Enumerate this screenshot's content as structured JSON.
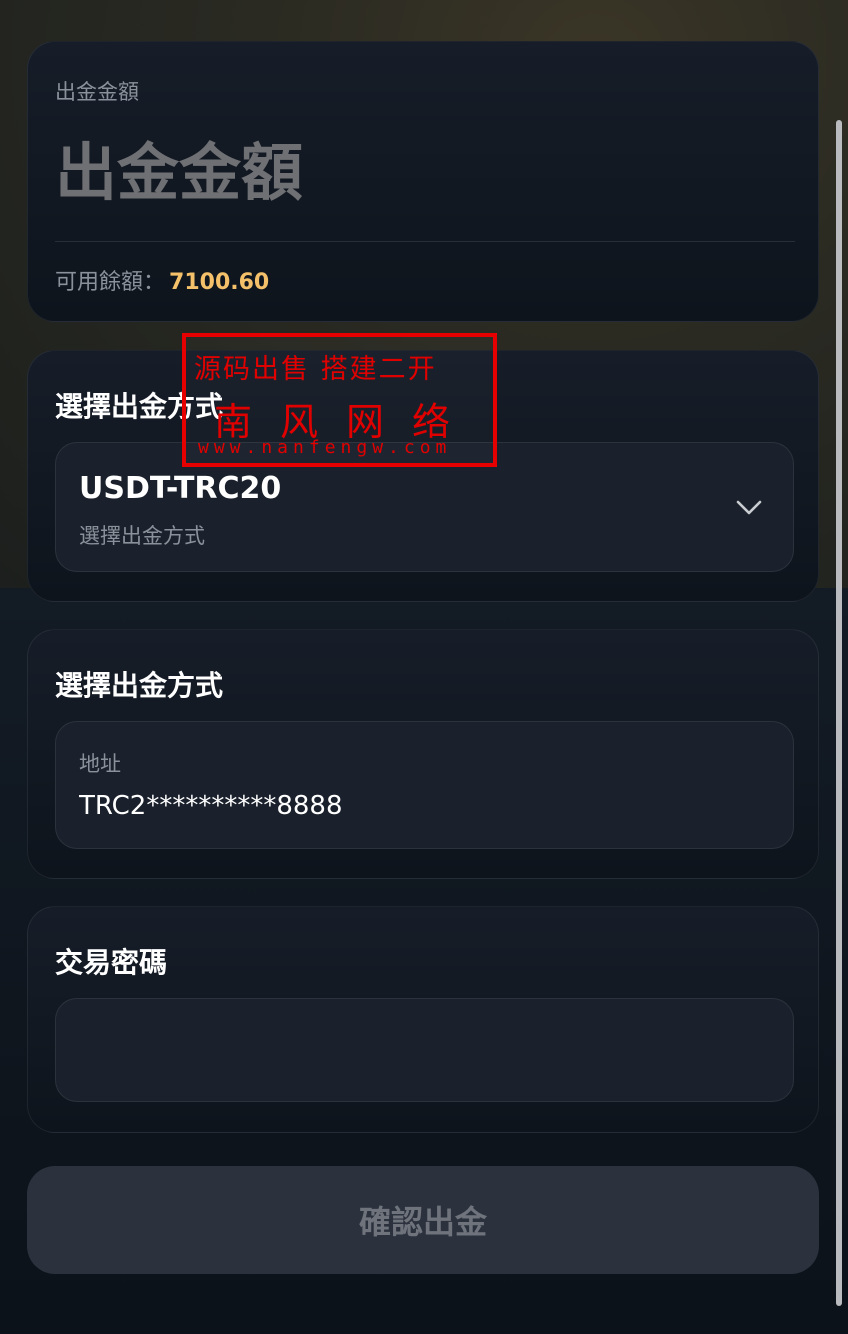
{
  "amount_card": {
    "label": "出金金額",
    "input_placeholder": "出金金額",
    "balance_label": "可用餘額：",
    "balance_value": "7100.60"
  },
  "method_card": {
    "title": "選擇出金方式",
    "selected_value": "USDT-TRC20",
    "hint": "選擇出金方式",
    "dropdown_icon": "chevron-down-icon"
  },
  "address_card": {
    "title": "選擇出金方式",
    "field_label": "地址",
    "field_value": "TRC2**********8888"
  },
  "password_card": {
    "title": "交易密碼",
    "field_value": ""
  },
  "submit": {
    "label": "確認出金"
  },
  "watermark": {
    "line1": "源码出售 搭建二开",
    "line2": "南风网络",
    "line3": "www.nanfengw.com"
  },
  "colors": {
    "accent_balance": "#f4c16a",
    "watermark_red": "#e60000",
    "button_bg": "#2b313d"
  }
}
